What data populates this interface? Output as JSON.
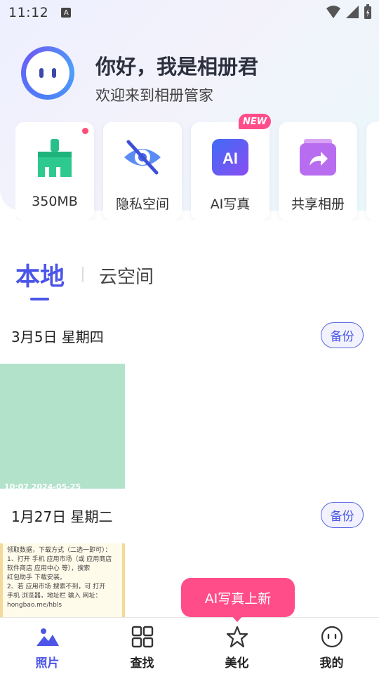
{
  "status_bar": {
    "time": "11:12",
    "notif_letter": "A"
  },
  "profile": {
    "title": "你好，我是相册君",
    "subtitle": "欢迎来到相册管家"
  },
  "feature_cards": [
    {
      "label": "350MB",
      "icon": "broom-clean-icon",
      "badge": "red-dot"
    },
    {
      "label": "隐私空间",
      "icon": "eye-hidden-icon"
    },
    {
      "label": "AI写真",
      "icon": "ai-icon",
      "icon_text": "AI"
    },
    {
      "label": "共享相册",
      "icon": "share-album-icon"
    }
  ],
  "new_badge": "NEW",
  "tabs": {
    "local": "本地",
    "cloud": "云空间"
  },
  "sections": [
    {
      "date": "3月5日 星期四",
      "backup": "备份",
      "photo_meta": "10:07 2024-05-25"
    },
    {
      "date": "1月27日 星期二",
      "backup": "备份"
    }
  ],
  "photo2_text": [
    "领取数据，下载方式（二选一即可）：",
    "1、打开 手机 应用市场（或 应用商店",
    "软件商店 应用中心 等），搜索",
    "红包助手 下载安装。",
    "2、若 应用市场 搜索不到，可 打开",
    "手机 浏览器，地址栏 输入 网址：",
    "hongbao.me/hbls"
  ],
  "ai_bubble": "AI写真上新",
  "bottom_nav": [
    {
      "label": "照片",
      "icon": "photos-icon",
      "active": true
    },
    {
      "label": "查找",
      "icon": "grid-icon",
      "active": false
    },
    {
      "label": "美化",
      "icon": "star-icon",
      "active": false
    },
    {
      "label": "我的",
      "icon": "profile-face-icon",
      "active": false
    }
  ],
  "colors": {
    "accent": "#4b55e8",
    "pink": "#ff4d8a",
    "photo_green": "#b3e2cb"
  }
}
